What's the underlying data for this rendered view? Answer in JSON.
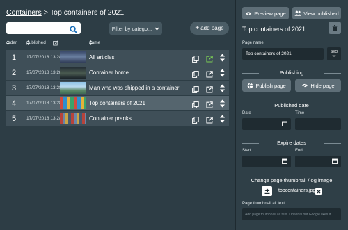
{
  "breadcrumb": {
    "root": "Containers",
    "separator": ">",
    "current": "Top containers of 2021"
  },
  "toolbar": {
    "search_placeholder": "",
    "filter_label": "Filter by catego...",
    "add_page_label": "add page"
  },
  "table": {
    "headers": {
      "order": "order",
      "published": "published",
      "name": "name"
    },
    "rows": [
      {
        "order": "1",
        "published": "17/07/2018 13:28",
        "name": "All articles",
        "thumb": "dark-crowd",
        "selected": false,
        "open_color": "#7ccf55"
      },
      {
        "order": "2",
        "published": "17/07/2018 13:28",
        "name": "Container home",
        "thumb": "dark-house",
        "selected": false,
        "open_color": "#ffffff"
      },
      {
        "order": "3",
        "published": "17/07/2018 13:28",
        "name": "Man who was shipped in a container",
        "thumb": "sky-building",
        "selected": false,
        "open_color": "#ffffff"
      },
      {
        "order": "4",
        "published": "17/07/2018 13:28",
        "name": "Top containers of 2021",
        "thumb": "colorful-stack",
        "selected": true,
        "open_color": "#ffffff"
      },
      {
        "order": "5",
        "published": "17/07/2018 13:28",
        "name": "Container pranks",
        "thumb": "red-yard",
        "selected": false,
        "open_color": "#ffffff"
      }
    ]
  },
  "panel": {
    "preview_label": "Preview page",
    "view_published_label": "View published",
    "title": "Top containers of 2021",
    "page_name_label": "Page name",
    "page_name_value": "Top containers of 2021",
    "seo_label": "SEO",
    "publishing_heading": "Publishing",
    "publish_label": "Publish page",
    "hide_label": "Hide page",
    "published_date_heading": "Published date",
    "date_label": "Date",
    "time_label": "Time",
    "expire_heading": "Expire dates",
    "start_label": "Start",
    "end_label": "End",
    "thumbnail_heading": "Change page thumbnail / og image",
    "thumbnail_file": "topcontainers.jpg",
    "alt_label": "Page thumbnail alt text",
    "alt_placeholder": "Add page thumbnail alt text. Optional but Google likes it"
  },
  "colors": {
    "accent_blue": "#1b6fb8",
    "link_green": "#7ccf55"
  }
}
